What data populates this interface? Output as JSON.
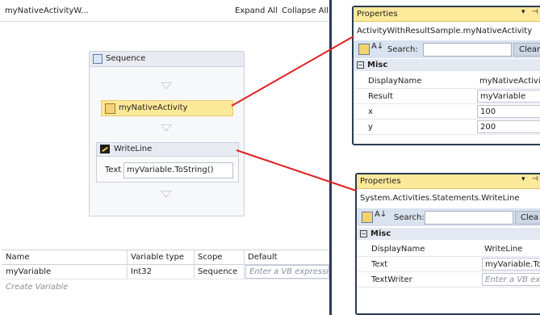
{
  "designer": {
    "title": "myNativeActivityW...",
    "expand_all": "Expand All",
    "collapse_all": "Collapse All",
    "sequence": {
      "label": "Sequence",
      "native_activity": "myNativeActivity",
      "writeline": {
        "label": "WriteLine",
        "text_label": "Text",
        "text_value": "myVariable.ToString()"
      }
    }
  },
  "variables": {
    "headers": [
      "Name",
      "Variable type",
      "Scope",
      "Default"
    ],
    "row": {
      "name": "myVariable",
      "type": "Int32",
      "scope": "Sequence",
      "default_placeholder": "Enter a VB expressic"
    },
    "create_label": "Create Variable"
  },
  "properties_top": {
    "title": "Properties",
    "subject": "ActivityWithResultSample.myNativeActivity",
    "search_label": "Search:",
    "clear_label": "Clear",
    "category": "Misc",
    "rows": [
      {
        "name": "DisplayName",
        "value": "myNativeActivit"
      },
      {
        "name": "Result",
        "value": "myVariable"
      },
      {
        "name": "x",
        "value": "100"
      },
      {
        "name": "y",
        "value": "200"
      }
    ]
  },
  "properties_bottom": {
    "title": "Properties",
    "subject": "System.Activities.Statements.WriteLine",
    "search_label": "Search:",
    "clear_label": "Clea",
    "category": "Misc",
    "rows": [
      {
        "name": "DisplayName",
        "value": "WriteLine"
      },
      {
        "name": "Text",
        "value": "myVariable.To"
      },
      {
        "name": "TextWriter",
        "value": "Enter a VB exp"
      }
    ]
  },
  "colors": {
    "callout_line": "#e02020",
    "panel_border": "#2b3a55",
    "title_bar": "#fde99a"
  }
}
